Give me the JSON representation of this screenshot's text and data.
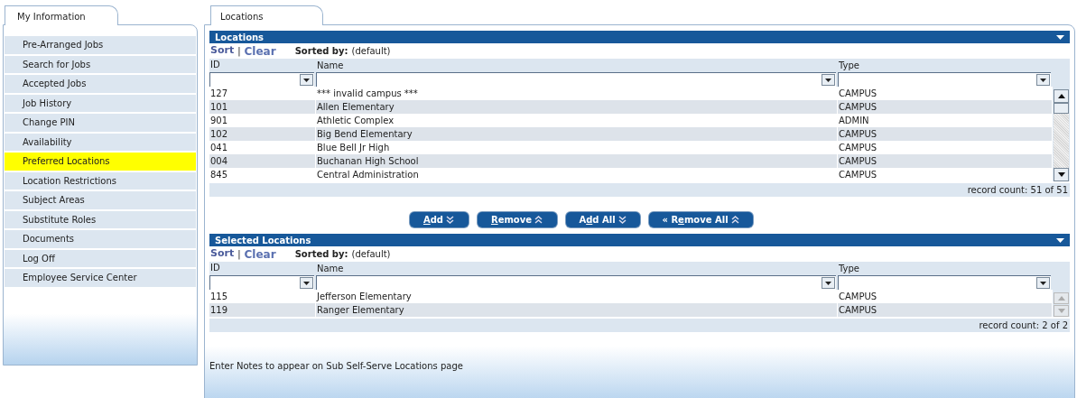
{
  "sidebar": {
    "tab": "My Information",
    "items": [
      {
        "label": "Pre-Arranged Jobs",
        "selected": false
      },
      {
        "label": "Search for Jobs",
        "selected": false
      },
      {
        "label": "Accepted Jobs",
        "selected": false
      },
      {
        "label": "Job History",
        "selected": false
      },
      {
        "label": "Change PIN",
        "selected": false
      },
      {
        "label": "Availability",
        "selected": false
      },
      {
        "label": "Preferred Locations",
        "selected": true
      },
      {
        "label": "Location Restrictions",
        "selected": false
      },
      {
        "label": "Subject Areas",
        "selected": false
      },
      {
        "label": "Substitute Roles",
        "selected": false
      },
      {
        "label": "Documents",
        "selected": false
      },
      {
        "label": "Log Off",
        "selected": false
      },
      {
        "label": "Employee Service Center",
        "selected": false
      }
    ]
  },
  "main": {
    "tab": "Locations",
    "grids": [
      {
        "title": "Locations",
        "sort": "Sort",
        "separator": "|",
        "clear": "Clear",
        "sorted_by_label": "Sorted by:",
        "sorted_by": "(default)",
        "columns": [
          "ID",
          "Name",
          "Type"
        ],
        "scroll_enabled": true,
        "rows": [
          [
            "127",
            "*** invalid campus ***",
            "CAMPUS"
          ],
          [
            "101",
            "Allen Elementary",
            "CAMPUS"
          ],
          [
            "901",
            "Athletic Complex",
            "ADMIN"
          ],
          [
            "102",
            "Big Bend Elementary",
            "CAMPUS"
          ],
          [
            "041",
            "Blue Bell Jr High",
            "CAMPUS"
          ],
          [
            "004",
            "Buchanan High School",
            "CAMPUS"
          ],
          [
            "845",
            "Central Administration",
            "CAMPUS"
          ]
        ],
        "record_count": "record count: 51 of 51"
      },
      {
        "title": "Selected Locations",
        "sort": "Sort",
        "separator": "|",
        "clear": "Clear",
        "sorted_by_label": "Sorted by:",
        "sorted_by": "(default)",
        "columns": [
          "ID",
          "Name",
          "Type"
        ],
        "scroll_enabled": false,
        "rows": [
          [
            "115",
            "Jefferson Elementary",
            "CAMPUS"
          ],
          [
            "119",
            "Ranger Elementary",
            "CAMPUS"
          ]
        ],
        "record_count": "record count: 2 of 2"
      }
    ],
    "buttons": [
      {
        "key": "A",
        "after": "dd",
        "kind": "add"
      },
      {
        "key": "R",
        "after": "emove",
        "kind": "remove"
      },
      {
        "before": "A",
        "key": "d",
        "after": "d All",
        "kind": "add"
      },
      {
        "prefix": "«",
        "before": " R",
        "key": "e",
        "after": "move All",
        "kind": "remove"
      }
    ],
    "notes": "Enter Notes to appear on Sub Self-Serve Locations page"
  }
}
